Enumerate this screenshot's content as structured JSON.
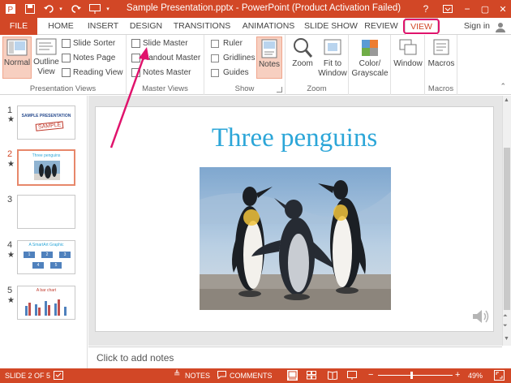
{
  "titlebar": {
    "title": "Sample Presentation.pptx - PowerPoint (Product Activation Failed)",
    "help": "?",
    "minimize": "−",
    "restore": "▢",
    "close": "✕"
  },
  "tabs": [
    "FILE",
    "HOME",
    "INSERT",
    "DESIGN",
    "TRANSITIONS",
    "ANIMATIONS",
    "SLIDE SHOW",
    "REVIEW",
    "VIEW"
  ],
  "account": {
    "signin": "Sign in"
  },
  "ribbon": {
    "presentation_views": {
      "label": "Presentation Views",
      "normal": "Normal",
      "outline_view": [
        "Outline",
        "View"
      ],
      "slide_sorter": "Slide Sorter",
      "notes_page": "Notes Page",
      "reading_view": "Reading View"
    },
    "master_views": {
      "label": "Master Views",
      "slide_master": "Slide Master",
      "handout_master": "Handout Master",
      "notes_master": "Notes Master"
    },
    "show": {
      "label": "Show",
      "ruler": "Ruler",
      "gridlines": "Gridlines",
      "guides": "Guides",
      "notes": "Notes"
    },
    "zoom": {
      "label": "Zoom",
      "zoom": "Zoom",
      "fit_to_window": [
        "Fit to",
        "Window"
      ]
    },
    "color": {
      "label": [
        "Color/",
        "Grayscale"
      ]
    },
    "window": {
      "label": "Window"
    },
    "macros": {
      "label": "Macros",
      "button": "Macros"
    }
  },
  "thumbnails": [
    {
      "num": "1",
      "star": "★",
      "title": "SAMPLE PRESENTATION",
      "stamp": "SAMPLE"
    },
    {
      "num": "2",
      "star": "★",
      "title": "Three penguins"
    },
    {
      "num": "3",
      "star": ""
    },
    {
      "num": "4",
      "star": "★",
      "title": "A SmartArt Graphic",
      "boxes": [
        "1",
        "2",
        "3",
        "4",
        "5"
      ]
    },
    {
      "num": "5",
      "star": "★",
      "title": "A bar chart"
    }
  ],
  "slide": {
    "title": "Three penguins"
  },
  "notes": {
    "placeholder": "Click to add notes"
  },
  "status": {
    "slide_info": "SLIDE 2 OF 5",
    "notes": "NOTES",
    "comments": "COMMENTS",
    "zoom": "49%"
  },
  "colors": {
    "accent": "#d24726",
    "highlight": "#e0136c",
    "slide_title": "#2ca6d8"
  }
}
